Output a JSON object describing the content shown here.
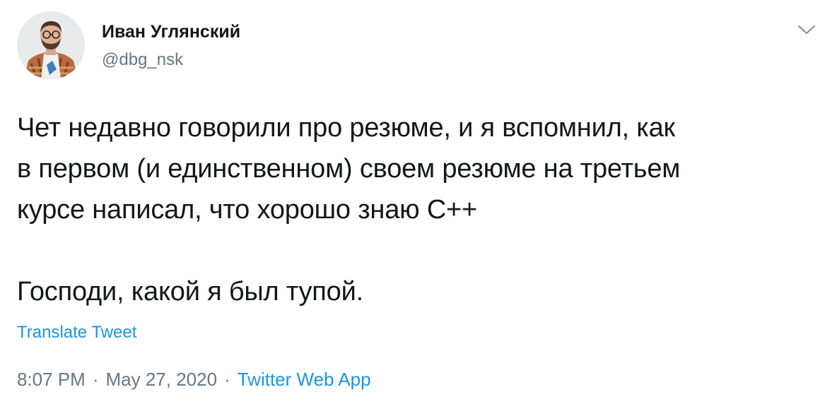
{
  "user": {
    "display_name": "Иван Углянский",
    "handle": "@dbg_nsk",
    "avatar_icon": "user-avatar"
  },
  "menu": {
    "caret_icon": "chevron-down-icon"
  },
  "tweet": {
    "lines": [
      "Чет недавно говорили про резюме, и я вспомнил, как",
      "в первом (и единственном) своем резюме на третьем",
      "курсе написал, что хорошо знаю С++"
    ],
    "line_last": "Господи, какой я был тупой."
  },
  "translate_label": "Translate Tweet",
  "meta": {
    "time": "8:07 PM",
    "separator": "·",
    "date": "May 27, 2020",
    "source": "Twitter Web App"
  },
  "colors": {
    "text": "#14171a",
    "secondary": "#657786",
    "link": "#1b95e0"
  }
}
